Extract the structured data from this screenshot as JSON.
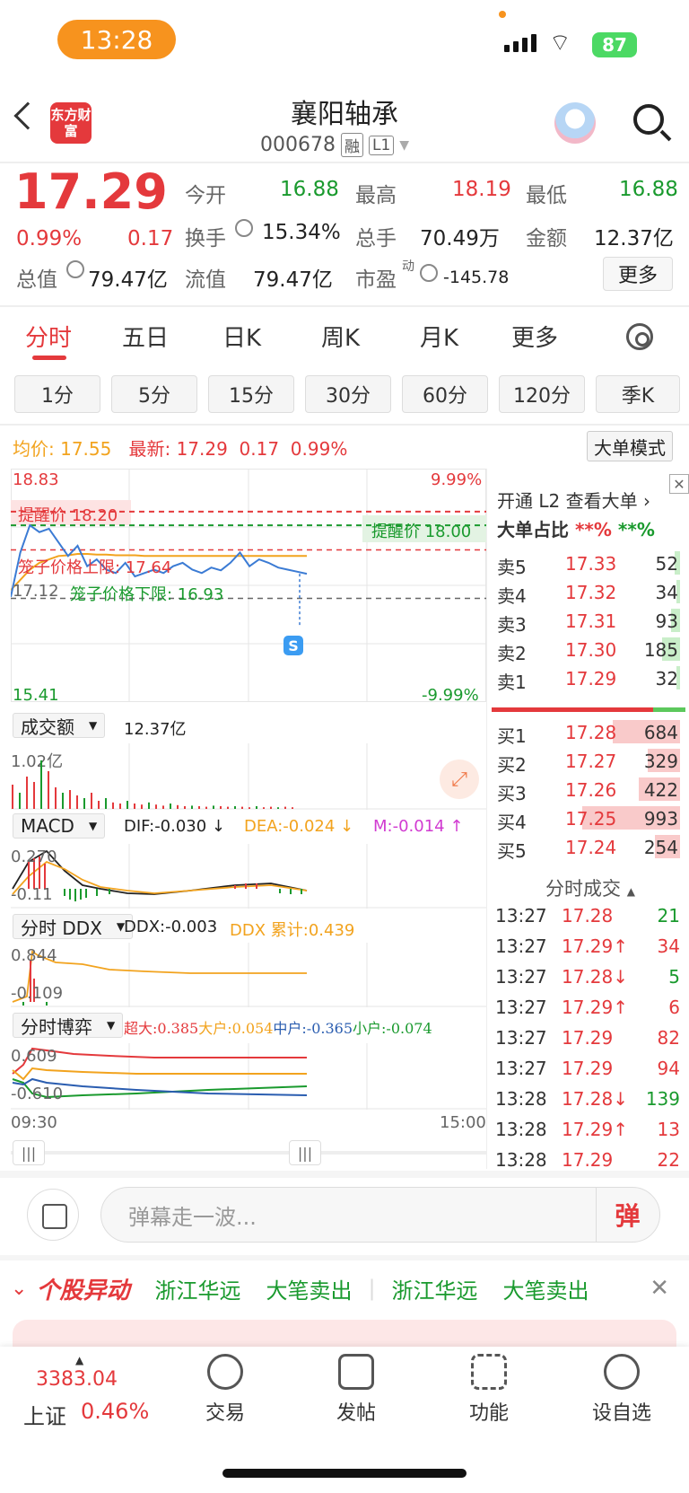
{
  "status": {
    "time": "13:28",
    "battery": "87"
  },
  "header": {
    "name": "襄阳轴承",
    "code": "000678",
    "tag1": "融",
    "tag2": "L1",
    "logo": "东方财富"
  },
  "quote": {
    "price": "17.29",
    "pct": "0.99%",
    "chg": "0.17",
    "open_label": "今开",
    "open": "16.88",
    "high_label": "最高",
    "high": "18.19",
    "low_label": "最低",
    "low": "16.88",
    "turnover_label": "换手",
    "turnover": "15.34%",
    "volume_label": "总手",
    "volume": "70.49万",
    "amount_label": "金额",
    "amount": "12.37亿",
    "mcap_label": "总值",
    "mcap": "79.47亿",
    "float_label": "流值",
    "float": "79.47亿",
    "pe_label": "市盈",
    "pe_sup": "动",
    "pe": "-145.78",
    "more": "更多"
  },
  "tabs": [
    "分时",
    "五日",
    "日K",
    "周K",
    "月K",
    "更多"
  ],
  "periods": [
    "1分",
    "5分",
    "15分",
    "30分",
    "60分",
    "120分",
    "季K"
  ],
  "chart_header": {
    "avg_label": "均价:",
    "avg": "17.55",
    "last_label": "最新:",
    "last": "17.29",
    "chg": "0.17",
    "pct": "0.99%",
    "big_order": "大单模式"
  },
  "chart_data": {
    "type": "line",
    "title": "",
    "x_start": "09:30",
    "x_end": "15:00",
    "ylim": [
      15.41,
      18.83
    ],
    "y_top": "18.83",
    "y_bottom": "15.41",
    "pct_top": "9.99%",
    "pct_bottom": "-9.99%",
    "mid_label": "17.12",
    "alert_high": "提醒价 18.20",
    "alert_low": "提醒价 18.00",
    "cage_high": "笼子价格上限: 17.64",
    "cage_low": "笼子价格下限: 16.93",
    "s_marker": "S",
    "series": [
      {
        "name": "",
        "values": [
          16.95,
          17.6,
          18.0,
          17.9,
          17.95,
          17.75,
          17.55,
          17.7,
          17.4,
          17.5,
          17.35,
          17.3,
          17.45,
          17.25,
          17.3,
          17.35,
          17.3,
          17.4,
          17.45,
          17.35,
          17.3,
          17.38,
          17.34,
          17.45,
          17.6,
          17.4,
          17.5,
          17.45,
          17.38,
          17.35,
          17.32,
          17.29
        ]
      },
      {
        "name": "",
        "values": [
          17.05,
          17.2,
          17.35,
          17.45,
          17.5,
          17.55,
          17.56,
          17.58,
          17.58,
          17.57,
          17.57,
          17.56,
          17.56,
          17.56,
          17.55,
          17.55,
          17.55,
          17.55,
          17.55,
          17.55,
          17.55,
          17.55,
          17.55,
          17.55,
          17.55,
          17.55,
          17.55,
          17.55,
          17.55,
          17.55,
          17.55,
          17.55
        ]
      }
    ]
  },
  "volume_panel": {
    "label": "成交额",
    "value": "12.37亿",
    "max": "1.02亿"
  },
  "macd_panel": {
    "label": "MACD",
    "dif": "DIF:-0.030 ↓",
    "dea": "DEA:-0.024 ↓",
    "m": "M:-0.014 ↑",
    "top": "0.270",
    "bottom": "-0.11"
  },
  "ddx_panel": {
    "label": "分时 DDX",
    "ddx": "DDX:-0.003",
    "acc": "DDX 累计:0.439",
    "top": "0.844",
    "bottom": "-0.109"
  },
  "game_panel": {
    "label": "分时博弈",
    "super": "超大:0.385",
    "large": "大户:0.054",
    "mid": "中户:-0.365",
    "small": "小户:-0.074",
    "top": "0.609",
    "bottom": "-0.610"
  },
  "orderbook": {
    "title": "开通 L2 查看大单 ›",
    "ratio_label": "大单占比",
    "ratio_red": "**%",
    "ratio_green": "**%",
    "asks": [
      {
        "label": "卖5",
        "price": "17.33",
        "vol": "52"
      },
      {
        "label": "卖4",
        "price": "17.32",
        "vol": "34"
      },
      {
        "label": "卖3",
        "price": "17.31",
        "vol": "93"
      },
      {
        "label": "卖2",
        "price": "17.30",
        "vol": "185"
      },
      {
        "label": "卖1",
        "price": "17.29",
        "vol": "32"
      }
    ],
    "bids": [
      {
        "label": "买1",
        "price": "17.28",
        "vol": "684"
      },
      {
        "label": "买2",
        "price": "17.27",
        "vol": "329"
      },
      {
        "label": "买3",
        "price": "17.26",
        "vol": "422"
      },
      {
        "label": "买4",
        "price": "17.25",
        "vol": "993"
      },
      {
        "label": "买5",
        "price": "17.24",
        "vol": "254"
      }
    ],
    "trades_title": "分时成交",
    "trades": [
      {
        "t": "13:27",
        "p": "17.28",
        "v": "21"
      },
      {
        "t": "13:27",
        "p": "17.29↑",
        "v": "34"
      },
      {
        "t": "13:27",
        "p": "17.28↓",
        "v": "5"
      },
      {
        "t": "13:27",
        "p": "17.29↑",
        "v": "6"
      },
      {
        "t": "13:27",
        "p": "17.29",
        "v": "82"
      },
      {
        "t": "13:27",
        "p": "17.29",
        "v": "94"
      },
      {
        "t": "13:28",
        "p": "17.28↓",
        "v": "139"
      },
      {
        "t": "13:28",
        "p": "17.29↑",
        "v": "13"
      },
      {
        "t": "13:28",
        "p": "17.29",
        "v": "22"
      }
    ]
  },
  "danmu": {
    "placeholder": "弹幕走一波...",
    "button": "弹"
  },
  "ticker": {
    "title": "个股异动",
    "items": [
      "浙江华远",
      "大笔卖出",
      "浙江华远",
      "大笔卖出"
    ]
  },
  "bottom": {
    "index": "3383.04",
    "index_name": "上证",
    "index_pct": "0.46%",
    "items": [
      "交易",
      "发帖",
      "功能",
      "设自选"
    ]
  }
}
